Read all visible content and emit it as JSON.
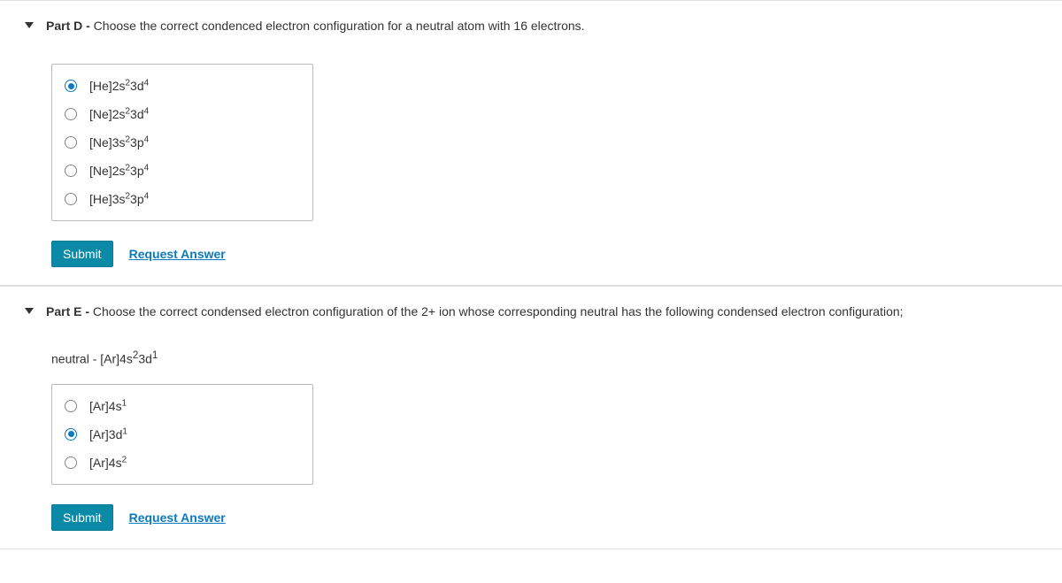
{
  "partD": {
    "title_bold": "Part D -",
    "title_rest": " Choose the correct condenced electron configuration for a neutral atom with 16 electrons.",
    "options": {
      "o0": {
        "core": "[He]",
        "shell1": "2s",
        "sup1": "2",
        "shell2": "3d",
        "sup2": "4"
      },
      "o1": {
        "core": "[Ne]",
        "shell1": "2s",
        "sup1": "2",
        "shell2": "3d",
        "sup2": "4"
      },
      "o2": {
        "core": "[Ne]",
        "shell1": "3s",
        "sup1": "2",
        "shell2": "3p",
        "sup2": "4"
      },
      "o3": {
        "core": "[Ne]",
        "shell1": "2s",
        "sup1": "2",
        "shell2": "3p",
        "sup2": "4"
      },
      "o4": {
        "core": "[He]",
        "shell1": "3s",
        "sup1": "2",
        "shell2": "3p",
        "sup2": "4"
      }
    },
    "selected_index": 0,
    "submit_label": "Submit",
    "request_label": "Request Answer"
  },
  "partE": {
    "title_bold": "Part E -",
    "title_rest": " Choose the correct condensed electron configuration of the 2+ ion whose corresponding neutral has the following condensed electron configuration;",
    "neutral_prefix": "neutral -  ",
    "neutral_cfg": {
      "core": "[Ar]",
      "shell1": "4s",
      "sup1": "2",
      "shell2": "3d",
      "sup2": "1"
    },
    "options": {
      "o0": {
        "core": "[Ar]",
        "shell1": "4s",
        "sup1": "1"
      },
      "o1": {
        "core": "[Ar]",
        "shell1": "3d",
        "sup1": "1"
      },
      "o2": {
        "core": "[Ar]",
        "shell1": "4s",
        "sup1": "2"
      }
    },
    "selected_index": 1,
    "submit_label": "Submit",
    "request_label": "Request Answer"
  }
}
